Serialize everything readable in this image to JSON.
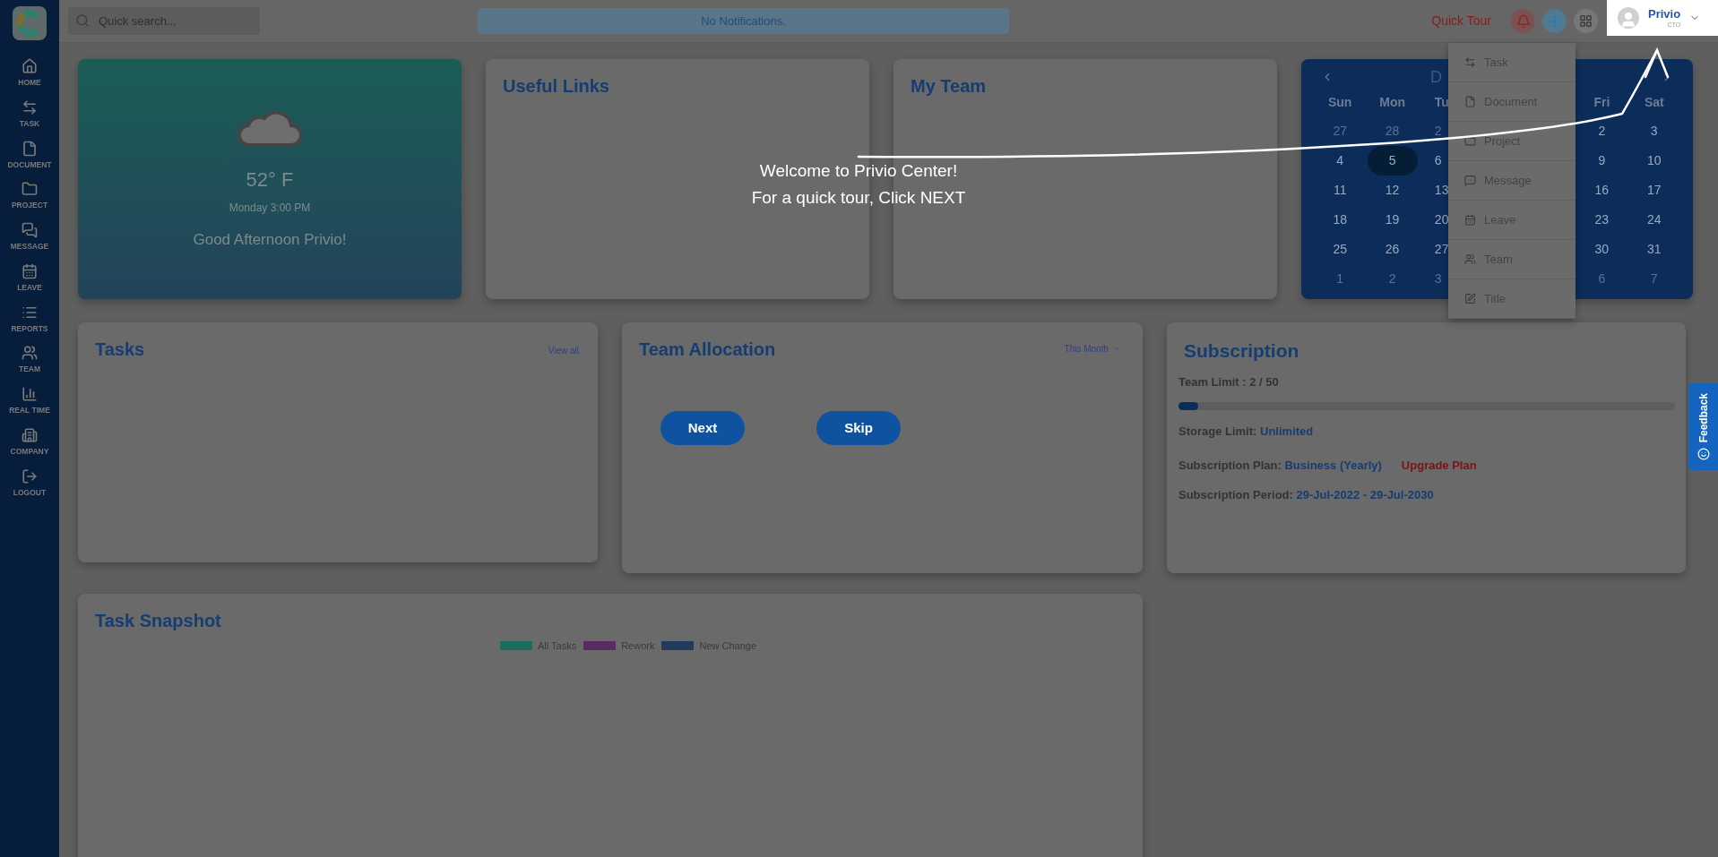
{
  "topbar": {
    "search": {
      "placeholder": "Quick search..."
    },
    "notification": "No Notifications.",
    "quick_tour": "Quick Tour",
    "user": {
      "name": "Privio",
      "role": "CTO"
    }
  },
  "sidebar": {
    "items": [
      {
        "label": "HOME"
      },
      {
        "label": "TASK"
      },
      {
        "label": "DOCUMENT"
      },
      {
        "label": "PROJECT"
      },
      {
        "label": "MESSAGE"
      },
      {
        "label": "LEAVE"
      },
      {
        "label": "REPORTS"
      },
      {
        "label": "TEAM"
      },
      {
        "label": "REAL TIME"
      },
      {
        "label": "COMPANY"
      },
      {
        "label": "LOGOUT"
      }
    ]
  },
  "weather": {
    "temperature": "52° F",
    "time": "Monday 3:00 PM",
    "greeting": "Good Afternoon Privio!"
  },
  "useful_links": {
    "title": "Useful Links"
  },
  "my_team": {
    "title": "My Team"
  },
  "calendar": {
    "month_title": "D",
    "left_columns": [
      {
        "header": "Sun",
        "days": [
          {
            "text": "27",
            "muted": true,
            "selected": false
          },
          {
            "text": "4",
            "muted": false,
            "selected": false
          },
          {
            "text": "11",
            "muted": false,
            "selected": false
          },
          {
            "text": "18",
            "muted": false,
            "selected": false
          },
          {
            "text": "25",
            "muted": false,
            "selected": false
          },
          {
            "text": "1",
            "muted": true,
            "selected": false
          }
        ]
      },
      {
        "header": "Mon",
        "days": [
          {
            "text": "28",
            "muted": true,
            "selected": false
          },
          {
            "text": "5",
            "muted": false,
            "selected": true
          },
          {
            "text": "12",
            "muted": false,
            "selected": false
          },
          {
            "text": "19",
            "muted": false,
            "selected": false
          },
          {
            "text": "26",
            "muted": false,
            "selected": false
          },
          {
            "text": "2",
            "muted": true,
            "selected": false
          }
        ]
      },
      {
        "header": "Tu",
        "days": [
          {
            "text": "2",
            "muted": true,
            "selected": false
          },
          {
            "text": "6",
            "muted": false,
            "selected": false
          },
          {
            "text": "13",
            "muted": false,
            "selected": false
          },
          {
            "text": "20",
            "muted": false,
            "selected": false
          },
          {
            "text": "27",
            "muted": false,
            "selected": false
          },
          {
            "text": "3",
            "muted": true,
            "selected": false
          }
        ]
      }
    ],
    "right_columns": [
      {
        "header": "Fri",
        "days": [
          {
            "text": "2",
            "muted": false,
            "selected": false
          },
          {
            "text": "9",
            "muted": false,
            "selected": false
          },
          {
            "text": "16",
            "muted": false,
            "selected": false
          },
          {
            "text": "23",
            "muted": false,
            "selected": false
          },
          {
            "text": "30",
            "muted": false,
            "selected": false
          },
          {
            "text": "6",
            "muted": true,
            "selected": false
          }
        ]
      },
      {
        "header": "Sat",
        "days": [
          {
            "text": "3",
            "muted": false,
            "selected": false
          },
          {
            "text": "10",
            "muted": false,
            "selected": false
          },
          {
            "text": "17",
            "muted": false,
            "selected": false
          },
          {
            "text": "24",
            "muted": false,
            "selected": false
          },
          {
            "text": "31",
            "muted": false,
            "selected": false
          },
          {
            "text": "7",
            "muted": true,
            "selected": false
          }
        ]
      }
    ]
  },
  "add_menu": {
    "items": [
      "Task",
      "Document",
      "Project",
      "Message",
      "Leave",
      "Team",
      "Title"
    ]
  },
  "tasks": {
    "title": "Tasks",
    "link": "View all"
  },
  "team_allocation": {
    "title": "Team Allocation",
    "period": "This Month"
  },
  "subscription": {
    "title": "Subscription",
    "team_limit": "Team Limit : 2 / 50",
    "level": 0.04,
    "storage": {
      "label": "Storage Limit:",
      "value": "Unlimited"
    },
    "plan": {
      "label": "Subscription Plan:",
      "value": "Business (Yearly)",
      "action": "Upgrade Plan"
    },
    "period": {
      "label": "Subscription Period:",
      "value": "29-Jul-2022 - 29-Jul-2030"
    }
  },
  "task_snapshot": {
    "title": "Task Snapshot",
    "legend": [
      {
        "label": "All Tasks",
        "color": "#1b6b5e"
      },
      {
        "label": "Rework",
        "color": "#5a2a63"
      },
      {
        "label": "New Change",
        "color": "#223a5c"
      }
    ]
  },
  "tour": {
    "lines": [
      "Welcome to Privio Center!",
      "For a quick tour, Click NEXT"
    ],
    "buttons": [
      "Next",
      "Skip"
    ]
  },
  "feedback": "Feedback"
}
